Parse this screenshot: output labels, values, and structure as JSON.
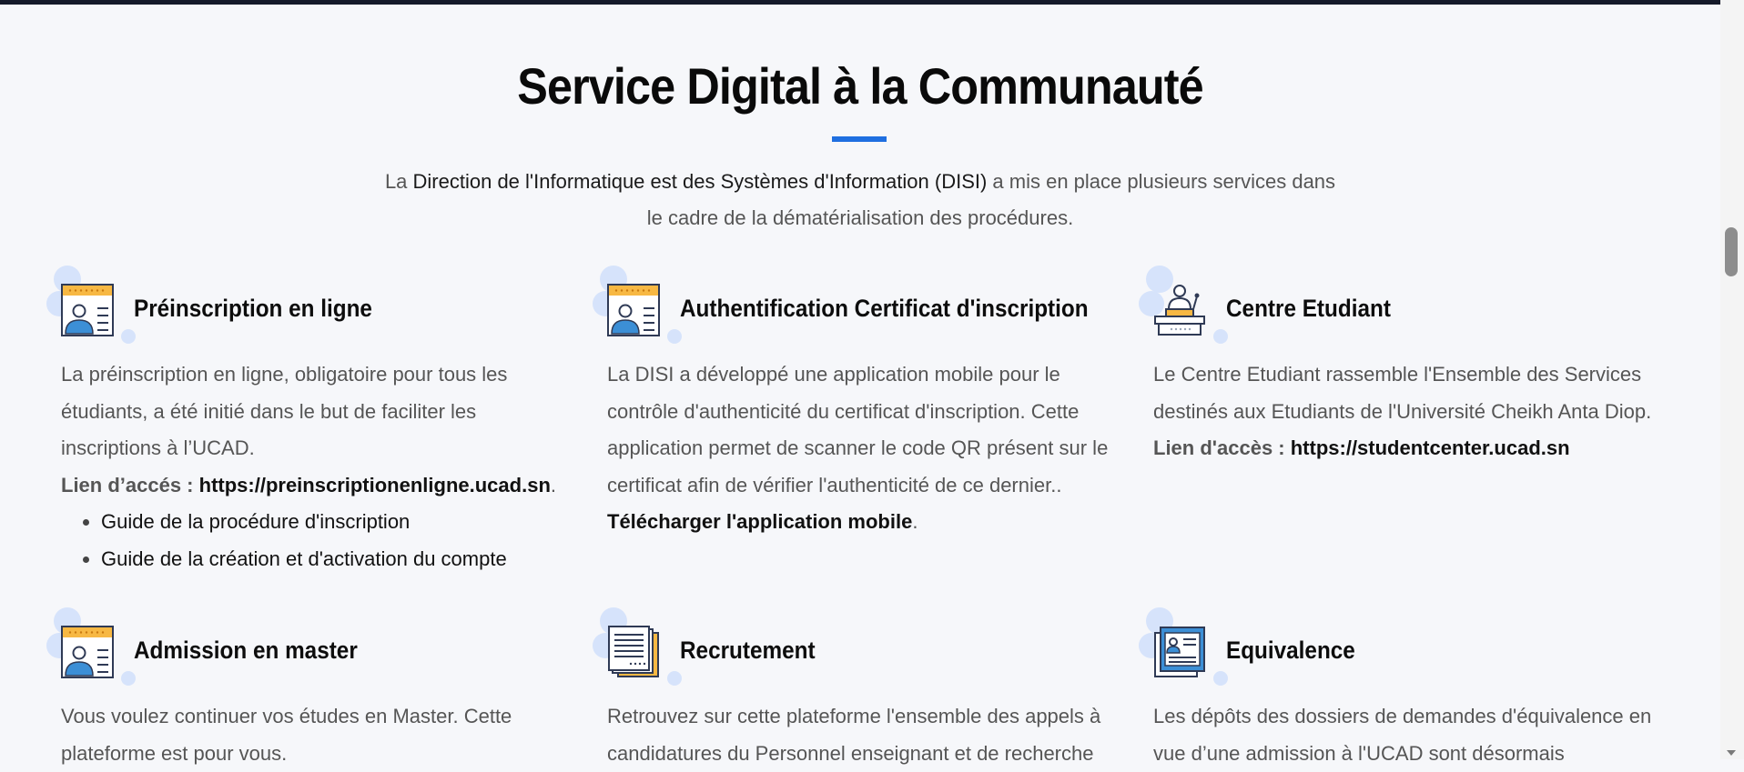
{
  "section": {
    "title": "Service Digital à la Communauté",
    "intro_prefix": "La ",
    "intro_strong": "Direction de l'Informatique est des Systèmes d'Information (DISI)",
    "intro_rest": " a mis en place plusieurs services dans le cadre de la dématérialisation des procédures."
  },
  "cards": [
    {
      "title": "Préinscription en ligne",
      "icon": "id-card-icon",
      "text": "La préinscription en ligne, obligatoire pour tous les étudiants, a été initié dans le but de faciliter les inscriptions à l’UCAD.",
      "link_label": "Lien d’accés : ",
      "link_url": "https://preinscriptionenligne.ucad.sn",
      "link_suffix": ".",
      "list": [
        "Guide de la procédure d'inscription",
        "Guide de la création et d'activation du compte"
      ]
    },
    {
      "title": "Authentification Certificat d'inscription",
      "icon": "id-card-icon",
      "text": "La DISI a développé une application mobile pour le contrôle d'authenticité du certificat d'inscription. Cette application permet de scanner le code QR présent sur le certificat afin de vérifier l'authenticité de ce dernier..",
      "link_url": "Télécharger l'application mobile",
      "link_suffix": "."
    },
    {
      "title": "Centre Etudiant",
      "icon": "podium-speaker-icon",
      "text": "Le Centre Etudiant rassemble l'Ensemble des Services destinés aux Etudiants de l'Université Cheikh Anta Diop.",
      "link_label": "Lien d'accès : ",
      "link_url": "https://studentcenter.ucad.sn"
    },
    {
      "title": "Admission en master",
      "icon": "id-card-icon",
      "text": "Vous voulez continuer vos études en Master. Cette plateforme est pour vous."
    },
    {
      "title": "Recrutement",
      "icon": "document-stack-icon",
      "text": "Retrouvez sur cette plateforme l'ensemble des appels à candidatures du Personnel enseignant et de recherche"
    },
    {
      "title": "Equivalence",
      "icon": "profile-document-icon",
      "text": "Les dépôts des dossiers de demandes d'équivalence en vue d’une admission à l'UCAD sont désormais"
    }
  ],
  "colors": {
    "accent": "#1f6fe0",
    "bubble": "#d6e3fb",
    "heading": "#0d0d0d",
    "body_text": "#555555"
  }
}
